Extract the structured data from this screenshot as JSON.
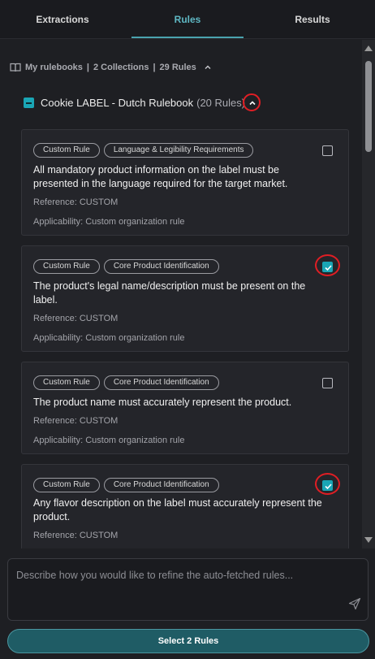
{
  "tabs": [
    {
      "label": "Extractions"
    },
    {
      "label": "Rules"
    },
    {
      "label": "Results"
    }
  ],
  "active_tab": "Rules",
  "rulebooks": {
    "label": "My rulebooks",
    "collections": "2 Collections",
    "rules": "29 Rules",
    "separator": "|"
  },
  "collection": {
    "name": "Cookie LABEL - Dutch Rulebook",
    "count": "(20 Rules)"
  },
  "rules": [
    {
      "tags": [
        "Custom Rule",
        "Language & Legibility Requirements"
      ],
      "text": "All mandatory product information on the label must be presented in the language required for the target market.",
      "reference": "Reference: CUSTOM",
      "applicability": "Applicability: Custom organization rule",
      "checked": false
    },
    {
      "tags": [
        "Custom Rule",
        "Core Product Identification"
      ],
      "text": "The product's legal name/description must be present on the label.",
      "reference": "Reference: CUSTOM",
      "applicability": "Applicability: Custom organization rule",
      "checked": true
    },
    {
      "tags": [
        "Custom Rule",
        "Core Product Identification"
      ],
      "text": "The product name must accurately represent the product.",
      "reference": "Reference: CUSTOM",
      "applicability": "Applicability: Custom organization rule",
      "checked": false
    },
    {
      "tags": [
        "Custom Rule",
        "Core Product Identification"
      ],
      "text": "Any flavor description on the label must accurately represent the product.",
      "reference": "Reference: CUSTOM",
      "applicability": "",
      "checked": true
    }
  ],
  "prompt": {
    "placeholder": "Describe how you would like to refine the auto-fetched rules...",
    "value": ""
  },
  "select_button": "Select 2 Rules",
  "colors": {
    "accent": "#1aa6b5",
    "highlight_ring": "#e01e24",
    "background": "#1e1f23"
  },
  "icons": [
    "book-icon",
    "chevron-up-icon",
    "send-icon",
    "checkbox-checked-icon"
  ]
}
